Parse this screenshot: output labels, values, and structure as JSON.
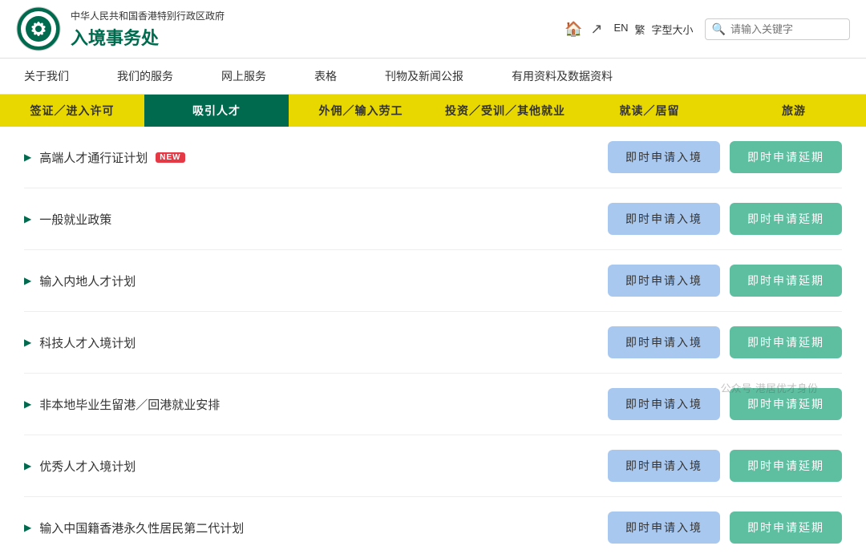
{
  "header": {
    "gov_name": "中华人民共和国香港特别行政区政府",
    "dept_name": "入境事务处",
    "search_placeholder": "请输入关键字",
    "lang_en": "EN",
    "lang_tc": "繁",
    "font_size_label": "字型大小"
  },
  "top_nav": {
    "items": [
      {
        "label": "关于我们"
      },
      {
        "label": "我们的服务"
      },
      {
        "label": "网上服务"
      },
      {
        "label": "表格"
      },
      {
        "label": "刊物及新闻公报"
      },
      {
        "label": "有用资料及数据资料"
      }
    ]
  },
  "sub_nav": {
    "items": [
      {
        "label": "签证／进入许可",
        "style": "yellow"
      },
      {
        "label": "吸引人才",
        "style": "teal-dark"
      },
      {
        "label": "外佣／输入劳工",
        "style": "yellow-light"
      },
      {
        "label": "投资／受训／其他就业",
        "style": "yellow2"
      },
      {
        "label": "就读／居留",
        "style": "yellow3"
      },
      {
        "label": "旅游",
        "style": "yellow4"
      }
    ]
  },
  "services": [
    {
      "label": "高端人才通行证计划",
      "is_new": true,
      "btn1": "即时申请入境",
      "btn2": "即时申请延期"
    },
    {
      "label": "一般就业政策",
      "is_new": false,
      "btn1": "即时申请入境",
      "btn2": "即时申请延期"
    },
    {
      "label": "输入内地人才计划",
      "is_new": false,
      "btn1": "即时申请入境",
      "btn2": "即时申请延期"
    },
    {
      "label": "科技人才入境计划",
      "is_new": false,
      "btn1": "即时申请入境",
      "btn2": "即时申请延期"
    },
    {
      "label": "非本地毕业生留港／回港就业安排",
      "is_new": false,
      "btn1": "即时申请入境",
      "btn2": "即时申请延期"
    },
    {
      "label": "优秀人才入境计划",
      "is_new": false,
      "btn1": "即时申请入境",
      "btn2": "即时申请延期"
    },
    {
      "label": "输入中国籍香港永久性居民第二代计划",
      "is_new": false,
      "btn1": "即时申请入境",
      "btn2": "即时申请延期"
    }
  ],
  "new_badge_text": "NEW",
  "watermark": "公众号·港居优才身份"
}
